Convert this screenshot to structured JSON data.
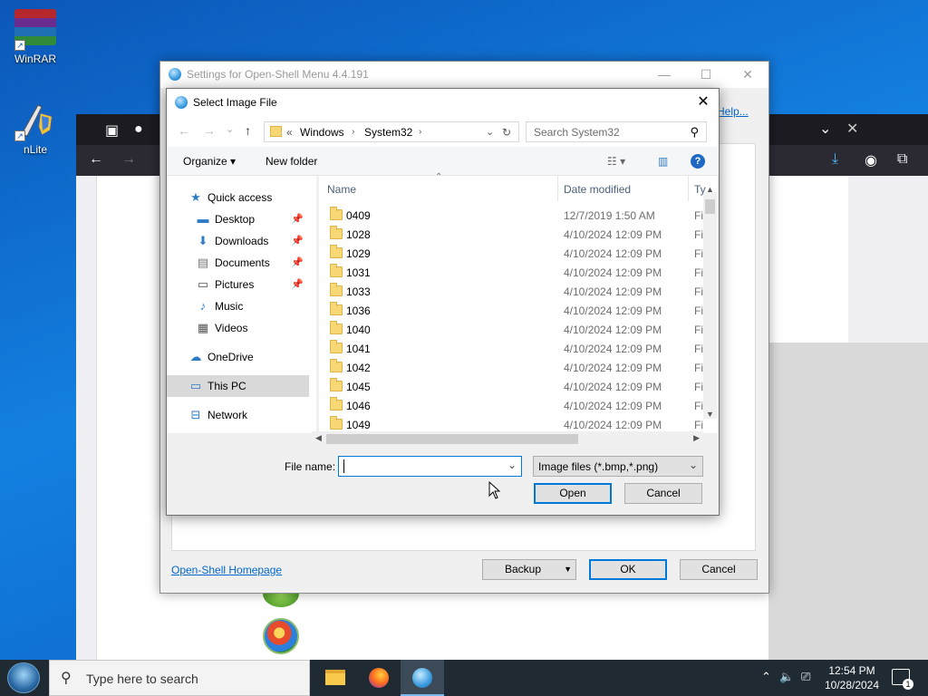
{
  "desktop": {
    "icons": [
      {
        "label": "WinRAR"
      },
      {
        "label": "nLite"
      }
    ]
  },
  "settings_window": {
    "title": "Settings for Open-Shell Menu 4.4.191",
    "help_link": "Help...",
    "homepage_link": "Open-Shell Homepage",
    "backup_label": "Backup",
    "ok_label": "OK",
    "cancel_label": "Cancel"
  },
  "dialog": {
    "title": "Select Image File",
    "breadcrumb": [
      "Windows",
      "System32"
    ],
    "breadcrumb_prefix": "«",
    "search_placeholder": "Search System32",
    "organize_label": "Organize",
    "new_folder_label": "New folder",
    "nav": [
      {
        "label": "Quick access",
        "icon": "star-icon",
        "pinned": false
      },
      {
        "label": "Desktop",
        "icon": "desktop-icon",
        "pinned": true
      },
      {
        "label": "Downloads",
        "icon": "download-icon",
        "pinned": true
      },
      {
        "label": "Documents",
        "icon": "document-icon",
        "pinned": true
      },
      {
        "label": "Pictures",
        "icon": "pictures-icon",
        "pinned": true
      },
      {
        "label": "Music",
        "icon": "music-icon",
        "pinned": false
      },
      {
        "label": "Videos",
        "icon": "videos-icon",
        "pinned": false
      },
      {
        "label": "OneDrive",
        "icon": "cloud-icon",
        "pinned": false
      },
      {
        "label": "This PC",
        "icon": "computer-icon",
        "pinned": false,
        "selected": true
      },
      {
        "label": "Network",
        "icon": "network-icon",
        "pinned": false
      }
    ],
    "columns": {
      "name": "Name",
      "date": "Date modified",
      "type": "Ty"
    },
    "files": [
      {
        "name": "0409",
        "date": "12/7/2019 1:50 AM",
        "type": "Fi"
      },
      {
        "name": "1028",
        "date": "4/10/2024 12:09 PM",
        "type": "Fi"
      },
      {
        "name": "1029",
        "date": "4/10/2024 12:09 PM",
        "type": "Fi"
      },
      {
        "name": "1031",
        "date": "4/10/2024 12:09 PM",
        "type": "Fi"
      },
      {
        "name": "1033",
        "date": "4/10/2024 12:09 PM",
        "type": "Fi"
      },
      {
        "name": "1036",
        "date": "4/10/2024 12:09 PM",
        "type": "Fi"
      },
      {
        "name": "1040",
        "date": "4/10/2024 12:09 PM",
        "type": "Fi"
      },
      {
        "name": "1041",
        "date": "4/10/2024 12:09 PM",
        "type": "Fi"
      },
      {
        "name": "1042",
        "date": "4/10/2024 12:09 PM",
        "type": "Fi"
      },
      {
        "name": "1045",
        "date": "4/10/2024 12:09 PM",
        "type": "Fi"
      },
      {
        "name": "1046",
        "date": "4/10/2024 12:09 PM",
        "type": "Fi"
      },
      {
        "name": "1049",
        "date": "4/10/2024 12:09 PM",
        "type": "Fi"
      }
    ],
    "file_name_label": "File name:",
    "file_name_value": "",
    "filter_value": "Image files (*.bmp,*.png)",
    "open_label": "Open",
    "cancel_label": "Cancel"
  },
  "taskbar": {
    "search_placeholder": "Type here to search",
    "time": "12:54 PM",
    "date": "10/28/2024",
    "notification_count": "1"
  }
}
